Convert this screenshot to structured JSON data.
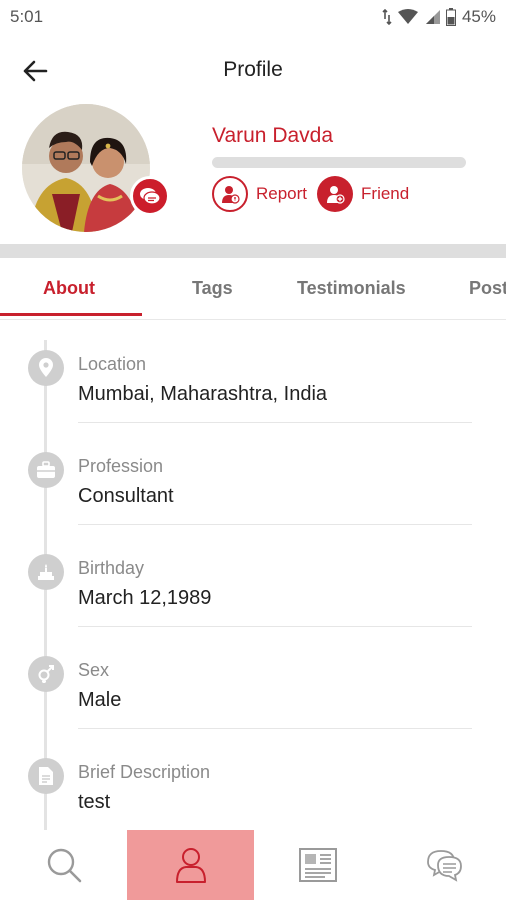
{
  "status_bar": {
    "time": "5:01",
    "battery_percent": "45%"
  },
  "app_bar": {
    "title": "Profile",
    "back_icon": "arrow-left-icon"
  },
  "profile": {
    "name": "Varun Davda",
    "actions": [
      {
        "label": "Report",
        "icon": "report-user-icon"
      },
      {
        "label": "Friend",
        "icon": "add-friend-icon"
      }
    ]
  },
  "tabs": [
    {
      "label": "About",
      "active": true
    },
    {
      "label": "Tags",
      "active": false
    },
    {
      "label": "Testimonials",
      "active": false
    },
    {
      "label": "Post",
      "active": false
    }
  ],
  "details": [
    {
      "label": "Location",
      "value": "Mumbai, Maharashtra, India",
      "icon": "location-pin-icon"
    },
    {
      "label": "Profession",
      "value": "Consultant",
      "icon": "briefcase-icon"
    },
    {
      "label": "Birthday",
      "value": "March 12,1989",
      "icon": "cake-icon"
    },
    {
      "label": "Sex",
      "value": "Male",
      "icon": "gender-icon"
    },
    {
      "label": "Brief Description",
      "value": "test",
      "icon": "document-icon"
    }
  ],
  "bottom_nav": [
    {
      "name": "search",
      "icon": "search-icon",
      "active": false
    },
    {
      "name": "profile",
      "icon": "person-icon",
      "active": true
    },
    {
      "name": "news",
      "icon": "newspaper-icon",
      "active": false
    },
    {
      "name": "chat",
      "icon": "chat-bubbles-icon",
      "active": false
    }
  ],
  "colors": {
    "accent": "#c8202d",
    "active_nav_bg": "#f09a9a",
    "muted_icon": "#cfcfcf"
  }
}
